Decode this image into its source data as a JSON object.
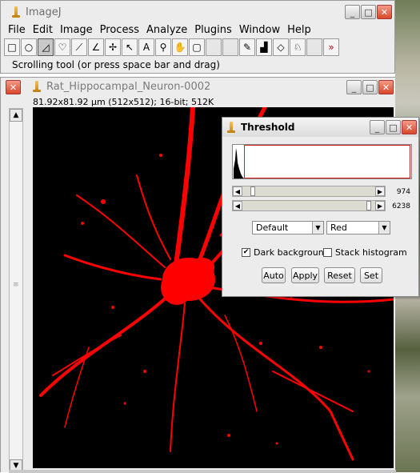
{
  "main_window": {
    "title": "ImageJ",
    "menu": [
      "File",
      "Edit",
      "Image",
      "Process",
      "Analyze",
      "Plugins",
      "Window",
      "Help"
    ],
    "toolbar_icons": [
      "rectangle-icon",
      "oval-icon",
      "polygon-icon",
      "freehand-icon",
      "line-icon",
      "angle-icon",
      "point-icon",
      "wand-icon",
      "text-icon",
      "magnifier-icon",
      "hand-icon",
      "color-picker-icon",
      "blank",
      "blank",
      "pencil-icon",
      "dropper-icon",
      "eraser-icon",
      "bucket-icon",
      "blank",
      "more-icon"
    ],
    "toolbar_glyphs": [
      "□",
      "○",
      "◿",
      "♡",
      "⟋",
      "∠",
      "✢",
      "↖",
      "A",
      "⚲",
      "✋",
      "▢",
      "",
      "",
      "✎",
      "▟",
      "◇",
      "♘",
      "",
      "»"
    ],
    "status": "Scrolling tool (or press space bar and drag)"
  },
  "image_window": {
    "title": "Rat_Hippocampal_Neuron-0002",
    "info": "81.92x81.92 µm (512x512); 16-bit; 512K"
  },
  "threshold": {
    "title": "Threshold",
    "slider1_value": "974",
    "slider2_value": "6238",
    "slider1_level": 0.06,
    "slider2_level": 0.97,
    "method": "Default",
    "display": "Red",
    "dark_background_label": "Dark background",
    "dark_background_checked": true,
    "stack_histogram_label": "Stack histogram",
    "stack_histogram_checked": false,
    "buttons": [
      "Auto",
      "Apply",
      "Reset",
      "Set"
    ]
  },
  "colors": {
    "threshold_overlay": "#ff0000",
    "image_background": "#000000",
    "window_bg": "#ececec"
  }
}
